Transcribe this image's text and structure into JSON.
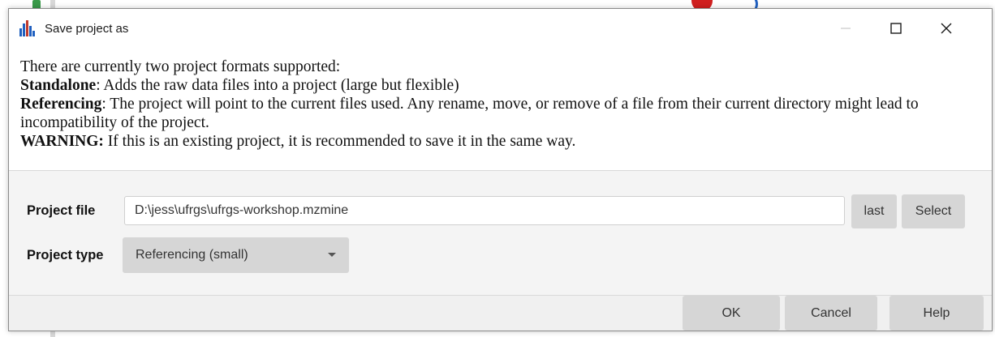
{
  "window": {
    "title": "Save project as",
    "app_icon": "bar-chart-icon",
    "controls": [
      "minimize-icon",
      "maximize-icon",
      "close-icon"
    ]
  },
  "description": {
    "intro": "There are currently two project formats supported:",
    "standalone_label": "Standalone",
    "standalone_text": ": Adds the raw data files into a project (large but flexible)",
    "referencing_label": "Referencing",
    "referencing_text": ": The project will point to the current files used. Any rename, move, or remove of a file from their current directory might lead to incompatibility of the project.",
    "warning_label": "WARNING:",
    "warning_text": " If this is an existing project, it is recommended to save it in the same way."
  },
  "form": {
    "project_file_label": "Project file",
    "project_file_value": "D:\\jess\\ufrgs\\ufrgs-workshop.mzmine",
    "last_button": "last",
    "select_button": "Select",
    "project_type_label": "Project type",
    "project_type_value": "Referencing (small)"
  },
  "footer": {
    "ok_button": "OK",
    "cancel_button": "Cancel",
    "help_button": "Help"
  },
  "colors": {
    "button_bg": "#d6d6d6",
    "form_bg": "#f4f4f4",
    "icon_red": "#c0392b",
    "icon_blue": "#2060c0"
  }
}
